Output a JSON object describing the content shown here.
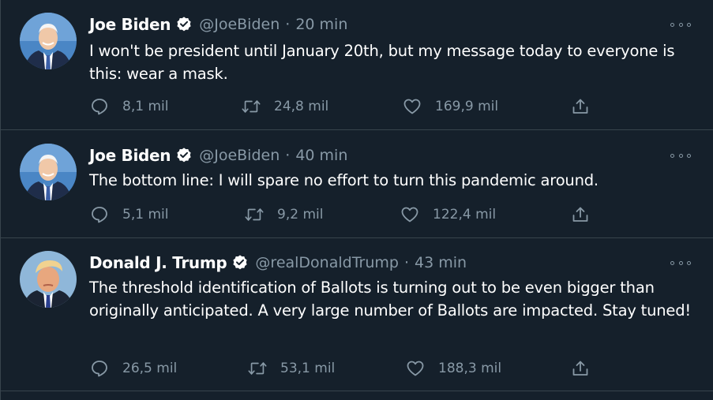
{
  "tweets": [
    {
      "name": "Joe Biden",
      "handle": "@JoeBiden",
      "separator": "·",
      "time": "20 min",
      "text": "I won't be president until January 20th, but my message today to everyone is this: wear a mask.",
      "avatar": "joe-biden",
      "replies": "8,1 mil",
      "retweets": "24,8 mil",
      "likes": "169,9 mil"
    },
    {
      "name": "Joe Biden",
      "handle": "@JoeBiden",
      "separator": "·",
      "time": "40 min",
      "text": "The bottom line: I will spare no effort to turn this pandemic around.",
      "avatar": "joe-biden",
      "replies": "5,1 mil",
      "retweets": "9,2 mil",
      "likes": "122,4 mil"
    },
    {
      "name": "Donald J. Trump",
      "handle": "@realDonaldTrump",
      "separator": "·",
      "time": "43 min",
      "text": "The threshold identification of Ballots is turning out to be even bigger than originally anticipated. A very large number of Ballots are impacted. Stay tuned!",
      "avatar": "donald-trump",
      "replies": "26,5 mil",
      "retweets": "53,1 mil",
      "likes": "188,3 mil"
    }
  ],
  "icons": {
    "reply": "reply-icon",
    "retweet": "retweet-icon",
    "like": "like-icon",
    "share": "share-icon",
    "more": "more-icon",
    "verified": "verified-badge-icon"
  },
  "colors": {
    "background": "#15202b",
    "border": "#38444d",
    "secondary_text": "#8899a6",
    "primary_text": "#ffffff"
  }
}
